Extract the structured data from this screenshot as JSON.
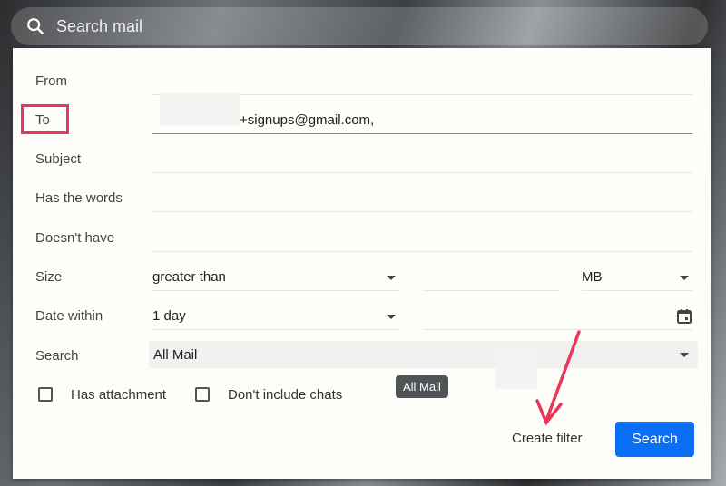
{
  "search_bar": {
    "placeholder": "Search mail"
  },
  "form": {
    "from": {
      "label": "From",
      "value": ""
    },
    "to": {
      "label": "To",
      "value": "+signups@gmail.com,"
    },
    "subject": {
      "label": "Subject",
      "value": ""
    },
    "has_words": {
      "label": "Has the words",
      "value": ""
    },
    "doesnt_have": {
      "label": "Doesn't have",
      "value": ""
    },
    "size": {
      "label": "Size",
      "comparator": "greater than",
      "value": "",
      "unit": "MB"
    },
    "date_within": {
      "label": "Date within",
      "value": "1 day",
      "date": ""
    },
    "search": {
      "label": "Search",
      "value": "All Mail"
    },
    "has_attachment": {
      "label": "Has attachment",
      "checked": false
    },
    "no_chats": {
      "label": "Don't include chats",
      "checked": false
    }
  },
  "tooltip": "All Mail",
  "buttons": {
    "create_filter": "Create filter",
    "search": "Search"
  },
  "annotation_color": "#e8375a",
  "accent": "#0b6ff5"
}
